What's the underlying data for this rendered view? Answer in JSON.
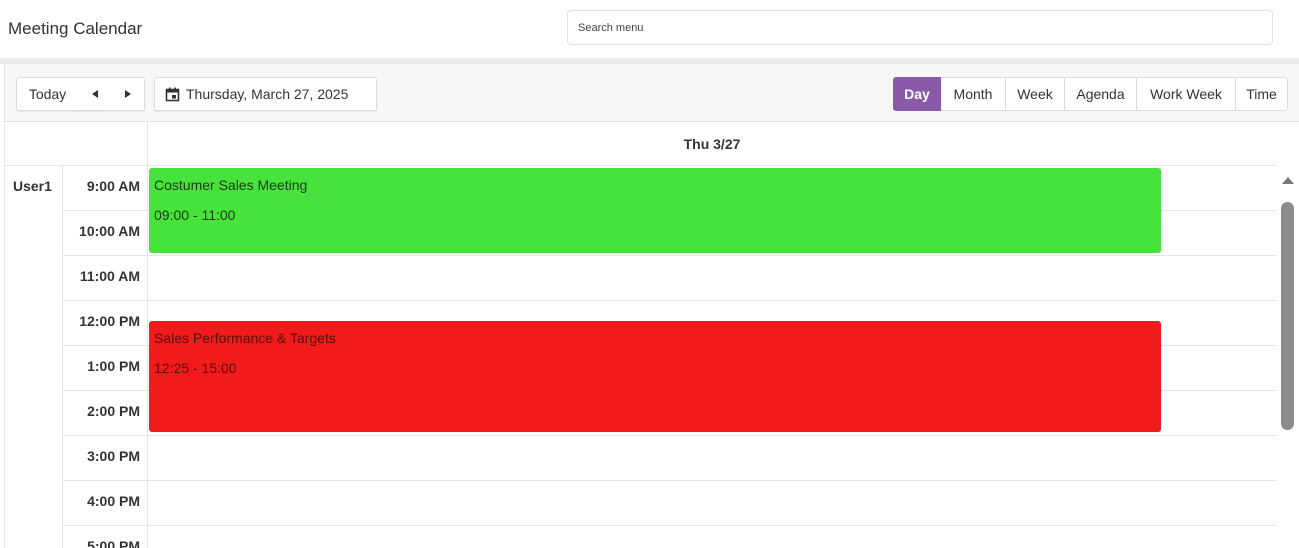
{
  "app": {
    "title": "Meeting Calendar"
  },
  "search": {
    "placeholder": "Search menu"
  },
  "toolbar": {
    "today_label": "Today",
    "date_label": "Thursday, March 27, 2025",
    "icons": {
      "prev": "triangle-left-icon",
      "next": "triangle-right-icon",
      "calendar": "calendar-icon"
    },
    "views": [
      "Day",
      "Month",
      "Week",
      "Agenda",
      "Work Week",
      "Time"
    ],
    "active_view": "Day",
    "accent_color": "#8a5aa8"
  },
  "grid": {
    "column_header": "Thu 3/27",
    "resource": "User1",
    "times": [
      "9:00 AM",
      "10:00 AM",
      "11:00 AM",
      "12:00 PM",
      "1:00 PM",
      "2:00 PM",
      "3:00 PM",
      "4:00 PM",
      "5:00 PM"
    ]
  },
  "events": [
    {
      "title": "Costumer Sales Meeting",
      "time": "09:00 - 11:00",
      "color": "#48e23d"
    },
    {
      "title": "Sales Performance & Targets",
      "time": "12:25 - 15:00",
      "color": "#f21b1b"
    }
  ]
}
